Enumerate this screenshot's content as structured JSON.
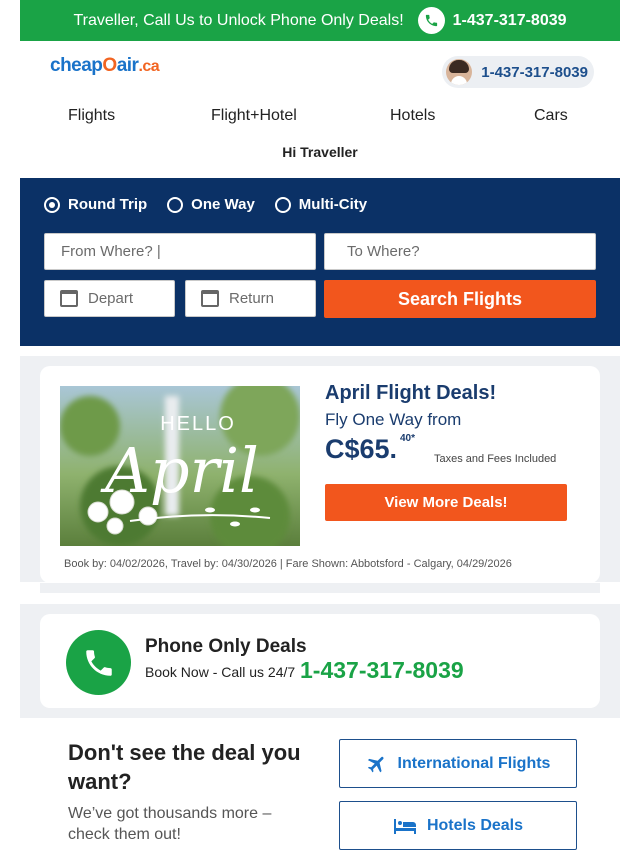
{
  "promo": {
    "text": "Traveller, Call Us to Unlock Phone Only Deals!",
    "phone": "1-437-317-8039",
    "icon": "phone-icon",
    "color": "#1aa346"
  },
  "header": {
    "logo": {
      "part1": "cheap",
      "part2": "O",
      "part3": "air",
      "part4": ".ca"
    },
    "phone": "1-437-317-8039",
    "nav": [
      "Flights",
      "Flight+Hotel",
      "Hotels",
      "Cars"
    ],
    "greeting": "Hi Traveller"
  },
  "search": {
    "trip_types": [
      {
        "label": "Round Trip",
        "selected": true
      },
      {
        "label": "One Way",
        "selected": false
      },
      {
        "label": "Multi-City",
        "selected": false
      }
    ],
    "from_placeholder": "From Where? |",
    "to_placeholder": "To Where?",
    "depart_placeholder": "Depart",
    "return_placeholder": "Return",
    "button": "Search Flights",
    "bg_color": "#0b3166",
    "accent_color": "#f2561d"
  },
  "deal": {
    "image_text_hello": "HELLO",
    "image_text_april": "April",
    "title": "April Flight Deals!",
    "subtitle": "Fly One Way from",
    "price": "C$65.",
    "cents": "40*",
    "taxes": "Taxes and Fees Included",
    "button": "View More Deals!",
    "fine_print": "Book by: 04/02/2026, Travel by: 04/30/2026  | Fare Shown: Abbotsford - Calgary, 04/29/2026"
  },
  "phone_only": {
    "title": "Phone Only Deals",
    "subtitle": "Book Now - Call us 24/7",
    "phone": "1-437-317-8039"
  },
  "more": {
    "title": "Don't see the deal you want?",
    "subtitle": "We’ve got thousands more – check them out!",
    "links": [
      {
        "label": "International Flights",
        "icon": "airplane-icon"
      },
      {
        "label": "Hotels Deals",
        "icon": "bed-icon"
      }
    ]
  }
}
